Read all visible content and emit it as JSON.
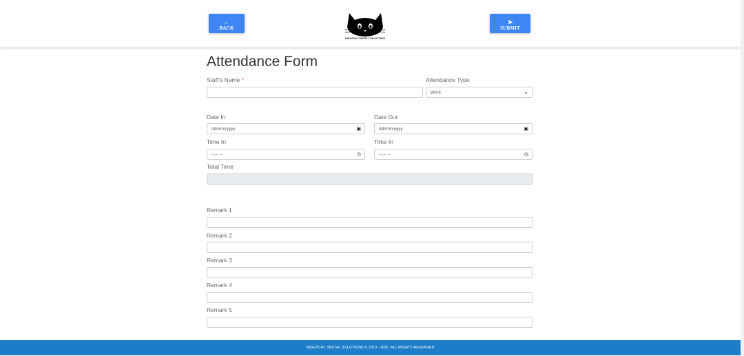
{
  "header": {
    "back_icon": "arrow-left-icon",
    "back_label": "BACK",
    "submit_icon": "paper-plane-icon",
    "submit_label": "SUBMIT",
    "logo_text": "NIGHTCAT DIGITAL SOLUTIONS"
  },
  "form": {
    "title": "Attendance Form",
    "staff_name": {
      "label": "Staff's Name",
      "required_mark": "*",
      "value": ""
    },
    "attendance_type": {
      "label": "Attendance Type",
      "value": "Work"
    },
    "date_in": {
      "label": "Date In",
      "placeholder": "dd/mm/yyyy"
    },
    "date_out": {
      "label": "Date Out",
      "placeholder": "dd/mm/yyyy"
    },
    "time_in": {
      "label": "Time In",
      "placeholder": "--:-- --"
    },
    "time_out": {
      "label": "Time In",
      "placeholder": "--:-- --"
    },
    "total_time": {
      "label": "Total Time",
      "value": ""
    },
    "remarks": [
      {
        "label": "Remark 1",
        "value": ""
      },
      {
        "label": "Remark 2",
        "value": ""
      },
      {
        "label": "Remark 3",
        "value": ""
      },
      {
        "label": "Remark 4",
        "value": ""
      },
      {
        "label": "Remark 5",
        "value": ""
      }
    ]
  },
  "footer": {
    "text": "NIGHTCAT DIGITAL SOLUTIONS © 2013 - 2020. ALL RIGHTS RESERVED"
  },
  "colors": {
    "accent": "#3f86f5",
    "footer": "#1d7dc8",
    "required": "#d9534f"
  }
}
